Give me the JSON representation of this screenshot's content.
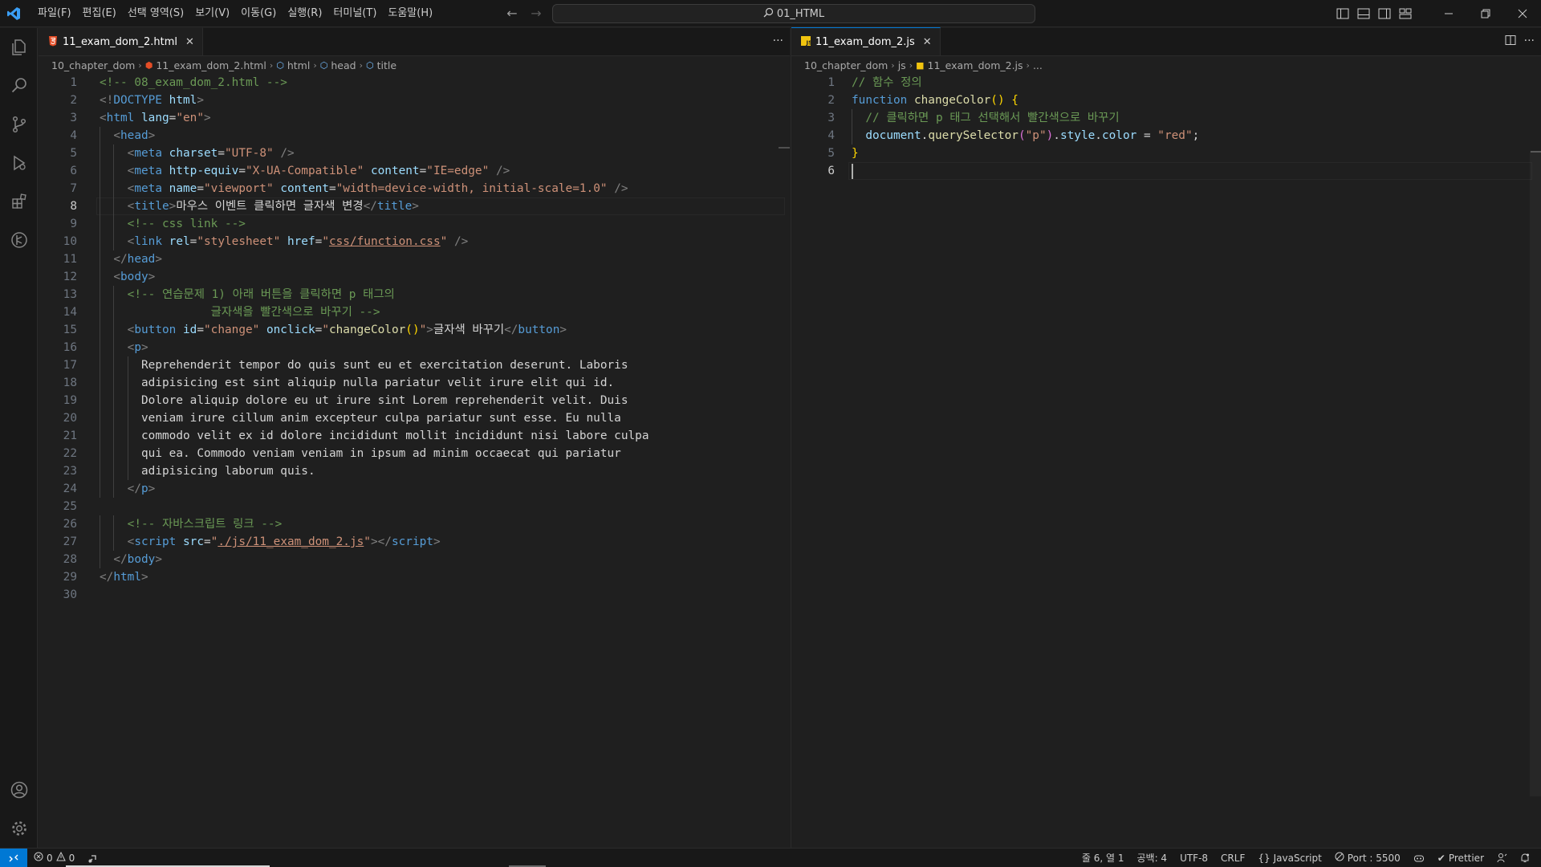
{
  "menu": [
    "파일(F)",
    "편집(E)",
    "선택 영역(S)",
    "보기(V)",
    "이동(G)",
    "실행(R)",
    "터미널(T)",
    "도움말(H)"
  ],
  "search": {
    "text": "01_HTML"
  },
  "colors": {
    "accent": "#0078d4",
    "editor_bg": "#1f1f1f",
    "html_icon": "#e44d26",
    "js_icon": "#f1c40f"
  },
  "activity": [
    "explorer-icon",
    "search-icon",
    "source-control-icon",
    "run-debug-icon",
    "extensions-icon",
    "git-graph-icon",
    "accounts-icon",
    "settings-gear-icon"
  ],
  "left": {
    "tab": {
      "label": "11_exam_dom_2.html",
      "icon": "html5-icon"
    },
    "breadcrumb": [
      "10_chapter_dom",
      "11_exam_dom_2.html",
      "html",
      "head",
      "title"
    ],
    "lines": [
      {
        "n": "1",
        "indent": 0,
        "parts": [
          [
            "c-com",
            "<!-- 08_exam_dom_2.html -->"
          ]
        ]
      },
      {
        "n": "2",
        "indent": 0,
        "parts": [
          [
            "c-br",
            "<!"
          ],
          [
            "c-tag",
            "DOCTYPE"
          ],
          [
            "c-txt",
            " "
          ],
          [
            "c-attr",
            "html"
          ],
          [
            "c-br",
            ">"
          ]
        ]
      },
      {
        "n": "3",
        "indent": 0,
        "parts": [
          [
            "c-br",
            "<"
          ],
          [
            "c-tag",
            "html"
          ],
          [
            "c-txt",
            " "
          ],
          [
            "c-attr",
            "lang"
          ],
          [
            "c-txt",
            "="
          ],
          [
            "c-str",
            "\"en\""
          ],
          [
            "c-br",
            ">"
          ]
        ]
      },
      {
        "n": "4",
        "indent": 1,
        "parts": [
          [
            "c-br",
            "<"
          ],
          [
            "c-tag",
            "head"
          ],
          [
            "c-br",
            ">"
          ]
        ]
      },
      {
        "n": "5",
        "indent": 2,
        "parts": [
          [
            "c-br",
            "<"
          ],
          [
            "c-tag",
            "meta"
          ],
          [
            "c-txt",
            " "
          ],
          [
            "c-attr",
            "charset"
          ],
          [
            "c-txt",
            "="
          ],
          [
            "c-str",
            "\"UTF-8\""
          ],
          [
            "c-txt",
            " "
          ],
          [
            "c-br",
            "/>"
          ]
        ]
      },
      {
        "n": "6",
        "indent": 2,
        "parts": [
          [
            "c-br",
            "<"
          ],
          [
            "c-tag",
            "meta"
          ],
          [
            "c-txt",
            " "
          ],
          [
            "c-attr",
            "http-equiv"
          ],
          [
            "c-txt",
            "="
          ],
          [
            "c-str",
            "\"X-UA-Compatible\""
          ],
          [
            "c-txt",
            " "
          ],
          [
            "c-attr",
            "content"
          ],
          [
            "c-txt",
            "="
          ],
          [
            "c-str",
            "\"IE=edge\""
          ],
          [
            "c-txt",
            " "
          ],
          [
            "c-br",
            "/>"
          ]
        ]
      },
      {
        "n": "7",
        "indent": 2,
        "parts": [
          [
            "c-br",
            "<"
          ],
          [
            "c-tag",
            "meta"
          ],
          [
            "c-txt",
            " "
          ],
          [
            "c-attr",
            "name"
          ],
          [
            "c-txt",
            "="
          ],
          [
            "c-str",
            "\"viewport\""
          ],
          [
            "c-txt",
            " "
          ],
          [
            "c-attr",
            "content"
          ],
          [
            "c-txt",
            "="
          ],
          [
            "c-str",
            "\"width=device-width, initial-scale=1.0\""
          ],
          [
            "c-txt",
            " "
          ],
          [
            "c-br",
            "/>"
          ]
        ]
      },
      {
        "n": "8",
        "indent": 2,
        "current": true,
        "parts": [
          [
            "c-br",
            "<"
          ],
          [
            "c-tag",
            "title"
          ],
          [
            "c-br",
            ">"
          ],
          [
            "c-txt",
            "마우스 이벤트 클릭하면 글자색 변경"
          ],
          [
            "c-br",
            "</"
          ],
          [
            "c-tag",
            "title"
          ],
          [
            "c-br",
            ">"
          ]
        ]
      },
      {
        "n": "9",
        "indent": 2,
        "parts": [
          [
            "c-com",
            "<!-- css link -->"
          ]
        ]
      },
      {
        "n": "10",
        "indent": 2,
        "parts": [
          [
            "c-br",
            "<"
          ],
          [
            "c-tag",
            "link"
          ],
          [
            "c-txt",
            " "
          ],
          [
            "c-attr",
            "rel"
          ],
          [
            "c-txt",
            "="
          ],
          [
            "c-str",
            "\"stylesheet\""
          ],
          [
            "c-txt",
            " "
          ],
          [
            "c-attr",
            "href"
          ],
          [
            "c-txt",
            "="
          ],
          [
            "c-str",
            "\""
          ],
          [
            "c-str ul",
            "css/function.css"
          ],
          [
            "c-str",
            "\""
          ],
          [
            "c-txt",
            " "
          ],
          [
            "c-br",
            "/>"
          ]
        ]
      },
      {
        "n": "11",
        "indent": 1,
        "parts": [
          [
            "c-br",
            "</"
          ],
          [
            "c-tag",
            "head"
          ],
          [
            "c-br",
            ">"
          ]
        ]
      },
      {
        "n": "12",
        "indent": 1,
        "parts": [
          [
            "c-br",
            "<"
          ],
          [
            "c-tag",
            "body"
          ],
          [
            "c-br",
            ">"
          ]
        ]
      },
      {
        "n": "13",
        "indent": 2,
        "parts": [
          [
            "c-com",
            "<!-- 연습문제 1) 아래 버튼을 클릭하면 p 태그의"
          ]
        ]
      },
      {
        "n": "14",
        "indent": 2,
        "parts": [
          [
            "c-com",
            "            글자색을 빨간색으로 바꾸기 -->"
          ]
        ]
      },
      {
        "n": "15",
        "indent": 2,
        "parts": [
          [
            "c-br",
            "<"
          ],
          [
            "c-tag",
            "button"
          ],
          [
            "c-txt",
            " "
          ],
          [
            "c-attr",
            "id"
          ],
          [
            "c-txt",
            "="
          ],
          [
            "c-str",
            "\"change\""
          ],
          [
            "c-txt",
            " "
          ],
          [
            "c-attr",
            "onclick"
          ],
          [
            "c-txt",
            "="
          ],
          [
            "c-str",
            "\""
          ],
          [
            "c-fn",
            "changeColor"
          ],
          [
            "c-brk",
            "()"
          ],
          [
            "c-str",
            "\""
          ],
          [
            "c-br",
            ">"
          ],
          [
            "c-txt",
            "글자색 바꾸기"
          ],
          [
            "c-br",
            "</"
          ],
          [
            "c-tag",
            "button"
          ],
          [
            "c-br",
            ">"
          ]
        ]
      },
      {
        "n": "16",
        "indent": 2,
        "parts": [
          [
            "c-br",
            "<"
          ],
          [
            "c-tag",
            "p"
          ],
          [
            "c-br",
            ">"
          ]
        ]
      },
      {
        "n": "17",
        "indent": 3,
        "parts": [
          [
            "c-txt",
            "Reprehenderit tempor do quis sunt eu et exercitation deserunt. Laboris"
          ]
        ]
      },
      {
        "n": "18",
        "indent": 3,
        "parts": [
          [
            "c-txt",
            "adipisicing est sint aliquip nulla pariatur velit irure elit qui id."
          ]
        ]
      },
      {
        "n": "19",
        "indent": 3,
        "parts": [
          [
            "c-txt",
            "Dolore aliquip dolore eu ut irure sint Lorem reprehenderit velit. Duis"
          ]
        ]
      },
      {
        "n": "20",
        "indent": 3,
        "parts": [
          [
            "c-txt",
            "veniam irure cillum anim excepteur culpa pariatur sunt esse. Eu nulla"
          ]
        ]
      },
      {
        "n": "21",
        "indent": 3,
        "parts": [
          [
            "c-txt",
            "commodo velit ex id dolore incididunt mollit incididunt nisi labore culpa"
          ]
        ]
      },
      {
        "n": "22",
        "indent": 3,
        "parts": [
          [
            "c-txt",
            "qui ea. Commodo veniam veniam in ipsum ad minim occaecat qui pariatur"
          ]
        ]
      },
      {
        "n": "23",
        "indent": 3,
        "parts": [
          [
            "c-txt",
            "adipisicing laborum quis."
          ]
        ]
      },
      {
        "n": "24",
        "indent": 2,
        "parts": [
          [
            "c-br",
            "</"
          ],
          [
            "c-tag",
            "p"
          ],
          [
            "c-br",
            ">"
          ]
        ]
      },
      {
        "n": "25",
        "indent": 0,
        "parts": []
      },
      {
        "n": "26",
        "indent": 2,
        "parts": [
          [
            "c-com",
            "<!-- 자바스크립트 링크 -->"
          ]
        ]
      },
      {
        "n": "27",
        "indent": 2,
        "parts": [
          [
            "c-br",
            "<"
          ],
          [
            "c-tag",
            "script"
          ],
          [
            "c-txt",
            " "
          ],
          [
            "c-attr",
            "src"
          ],
          [
            "c-txt",
            "="
          ],
          [
            "c-str",
            "\""
          ],
          [
            "c-str ul",
            "./js/11_exam_dom_2.js"
          ],
          [
            "c-str",
            "\""
          ],
          [
            "c-br",
            "></"
          ],
          [
            "c-tag",
            "script"
          ],
          [
            "c-br",
            ">"
          ]
        ]
      },
      {
        "n": "28",
        "indent": 1,
        "parts": [
          [
            "c-br",
            "</"
          ],
          [
            "c-tag",
            "body"
          ],
          [
            "c-br",
            ">"
          ]
        ]
      },
      {
        "n": "29",
        "indent": 0,
        "parts": [
          [
            "c-br",
            "</"
          ],
          [
            "c-tag",
            "html"
          ],
          [
            "c-br",
            ">"
          ]
        ]
      },
      {
        "n": "30",
        "indent": 0,
        "parts": []
      }
    ]
  },
  "right": {
    "tab": {
      "label": "11_exam_dom_2.js",
      "icon": "javascript-icon"
    },
    "breadcrumb": [
      "10_chapter_dom",
      "js",
      "11_exam_dom_2.js",
      "..."
    ],
    "lines": [
      {
        "n": "1",
        "indent": 0,
        "parts": [
          [
            "c-com",
            "// 함수 정의"
          ]
        ]
      },
      {
        "n": "2",
        "indent": 0,
        "parts": [
          [
            "c-kw",
            "function"
          ],
          [
            "c-txt",
            " "
          ],
          [
            "c-fn",
            "changeColor"
          ],
          [
            "c-brk",
            "()"
          ],
          [
            "c-txt",
            " "
          ],
          [
            "c-brk",
            "{"
          ]
        ]
      },
      {
        "n": "3",
        "indent": 1,
        "parts": [
          [
            "c-com",
            "// 클릭하면 p 태그 선택해서 빨간색으로 바꾸기"
          ]
        ]
      },
      {
        "n": "4",
        "indent": 1,
        "parts": [
          [
            "c-var",
            "document"
          ],
          [
            "c-txt",
            "."
          ],
          [
            "c-fn",
            "querySelector"
          ],
          [
            "c-brk2",
            "("
          ],
          [
            "c-str",
            "\"p\""
          ],
          [
            "c-brk2",
            ")"
          ],
          [
            "c-txt",
            "."
          ],
          [
            "c-var",
            "style"
          ],
          [
            "c-txt",
            "."
          ],
          [
            "c-var",
            "color"
          ],
          [
            "c-txt",
            " = "
          ],
          [
            "c-str",
            "\"red\""
          ],
          [
            "c-txt",
            ";"
          ]
        ]
      },
      {
        "n": "5",
        "indent": 0,
        "parts": [
          [
            "c-brk",
            "}"
          ]
        ]
      },
      {
        "n": "6",
        "indent": 0,
        "current": true,
        "parts": []
      }
    ]
  },
  "status": {
    "errors": "0",
    "warnings": "0",
    "position": "줄 6, 열 1",
    "spaces": "공백: 4",
    "encoding": "UTF-8",
    "eol": "CRLF",
    "language": "JavaScript",
    "port": "Port : 5500",
    "prettier": "Prettier"
  }
}
